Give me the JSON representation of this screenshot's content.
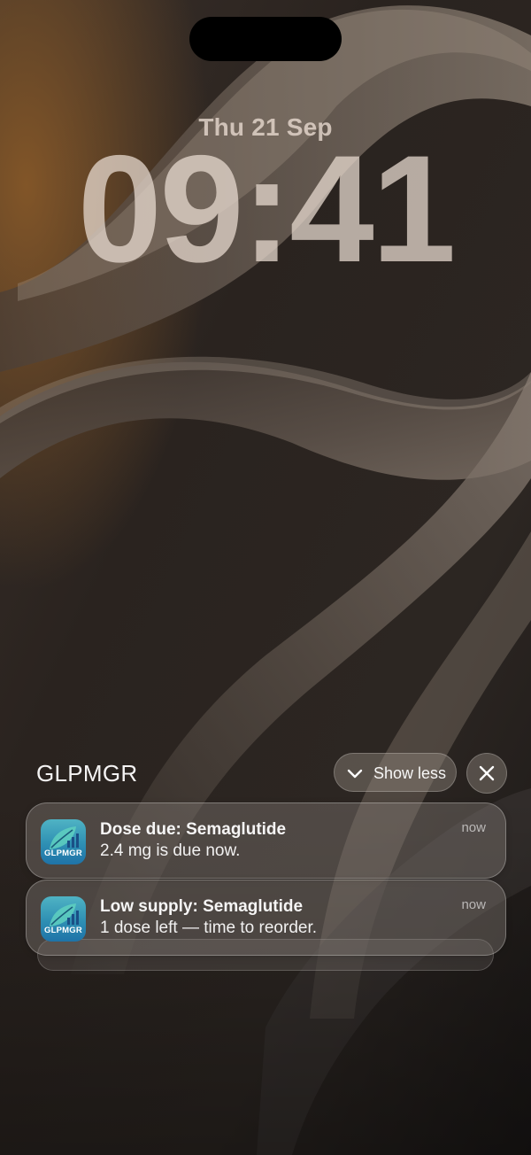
{
  "lock_screen": {
    "date": "Thu 21 Sep",
    "time": "09:41"
  },
  "notification_group": {
    "app_name": "GLPMGR",
    "show_less_label": "Show less",
    "show_less_icon": "chevron-down-icon",
    "close_icon": "close-icon"
  },
  "notifications": [
    {
      "icon_text": "GLPMGR",
      "title": "Dose due: Semaglutide",
      "body": "2.4 mg is due now.",
      "time": "now"
    },
    {
      "icon_text": "GLPMGR",
      "title": "Low supply: Semaglutide",
      "body": "1 dose left — time to reorder.",
      "time": "now"
    }
  ],
  "colors": {
    "wallpaper_base": "#1e1a17",
    "wallpaper_highlight": "#8a7c70",
    "wallpaper_warm": "#7a4a1e",
    "app_icon_top": "#4fb3c4",
    "app_icon_bottom": "#1f73a8"
  }
}
